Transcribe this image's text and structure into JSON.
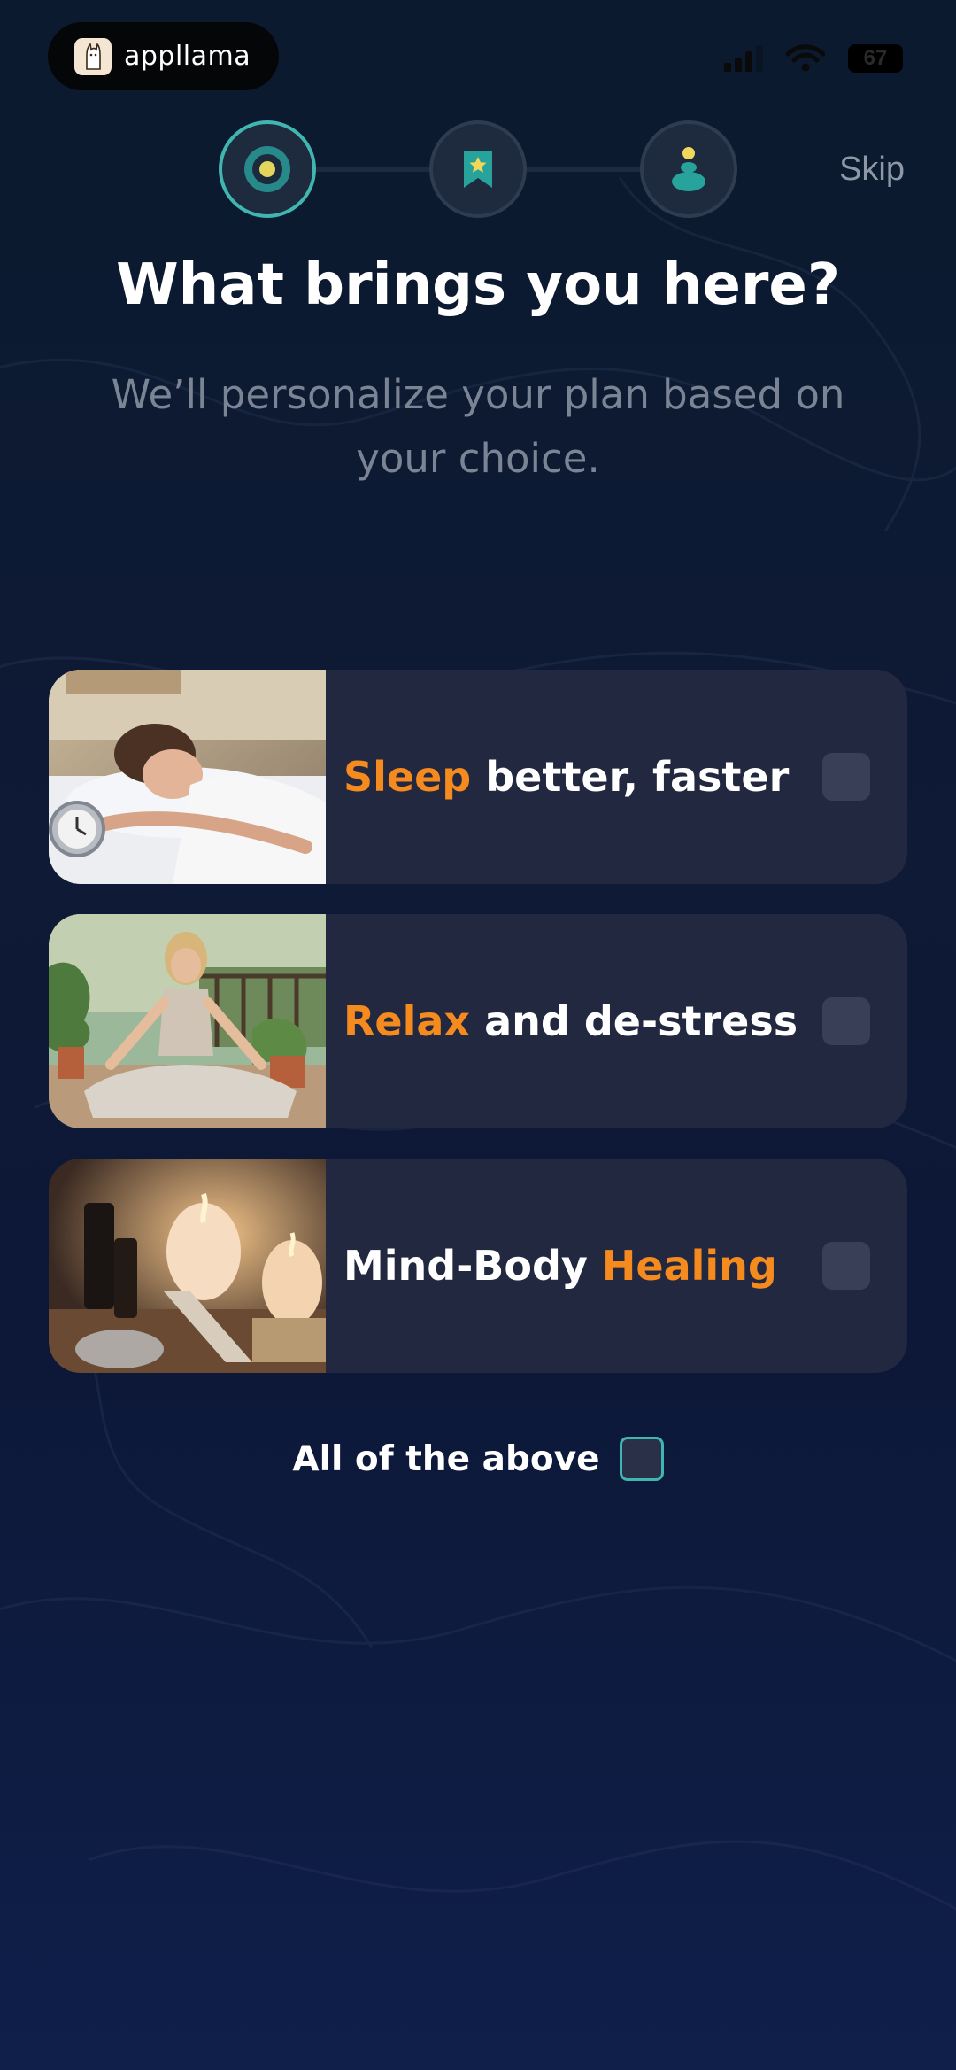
{
  "status_bar": {
    "brand_name": "appllama",
    "battery_level": "67"
  },
  "stepper": {
    "steps": [
      {
        "icon": "target-icon",
        "active": true
      },
      {
        "icon": "bookmark-star-icon",
        "active": false
      },
      {
        "icon": "meditation-icon",
        "active": false
      }
    ],
    "skip_label": "Skip"
  },
  "header": {
    "title": "What brings you here?",
    "subtitle": "We’ll personalize your plan based on your choice."
  },
  "options": [
    {
      "accent_first": true,
      "accent": "Sleep",
      "rest": " better, faster",
      "image": "woman-sleeping-with-alarm-clock",
      "checked": false
    },
    {
      "accent_first": true,
      "accent": "Relax",
      "rest": " and de-stress",
      "image": "woman-meditating-on-balcony",
      "checked": false
    },
    {
      "accent_first": false,
      "rest": "Mind-Body ",
      "accent": "Healing",
      "image": "candles-and-oils",
      "checked": false
    }
  ],
  "all_of_above": {
    "label": "All of the above",
    "checked": false
  },
  "colors": {
    "accent_orange": "#f58a1f",
    "teal": "#3fb6b0",
    "card_bg": "#222840"
  }
}
